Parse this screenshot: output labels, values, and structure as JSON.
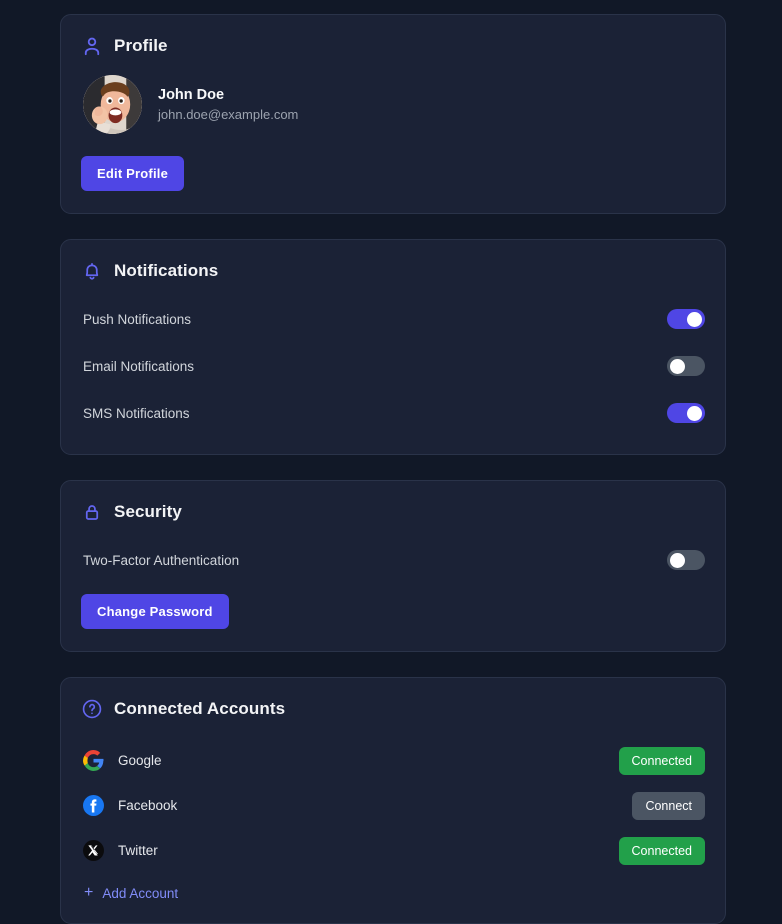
{
  "theme": {
    "page_bg": "#111827",
    "card_bg": "#1b2236",
    "card_border": "#2a3349",
    "accent": "#4f46e5",
    "accent_light": "#6366f1",
    "link": "#818cf8",
    "success": "#22a04a",
    "toggle_off": "#4b5563"
  },
  "profile": {
    "icon": "user-icon",
    "title": "Profile",
    "name": "John Doe",
    "email": "john.doe@example.com",
    "avatar_alt": "user-photo",
    "edit_button": "Edit Profile"
  },
  "notifications": {
    "icon": "bell-icon",
    "title": "Notifications",
    "items": [
      {
        "label": "Push Notifications",
        "enabled": true
      },
      {
        "label": "Email Notifications",
        "enabled": false
      },
      {
        "label": "SMS Notifications",
        "enabled": true
      }
    ]
  },
  "security": {
    "icon": "lock-icon",
    "title": "Security",
    "two_factor_label": "Two-Factor Authentication",
    "two_factor_enabled": false,
    "change_password_button": "Change Password"
  },
  "connected_accounts": {
    "icon": "help-circle-icon",
    "title": "Connected Accounts",
    "items": [
      {
        "name": "Google",
        "icon": "google-icon",
        "status": "Connected",
        "connected": true
      },
      {
        "name": "Facebook",
        "icon": "facebook-icon",
        "status": "Connect",
        "connected": false
      },
      {
        "name": "Twitter",
        "icon": "twitter-x-icon",
        "status": "Connected",
        "connected": true
      }
    ],
    "add_account_label": "Add Account",
    "add_account_icon": "plus-icon"
  }
}
